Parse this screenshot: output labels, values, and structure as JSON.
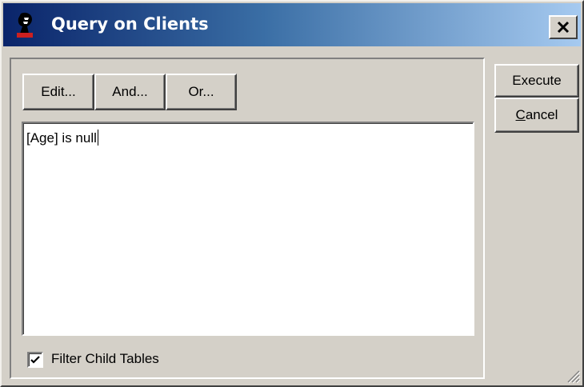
{
  "window": {
    "title": "Query on Clients",
    "close_label": "✕"
  },
  "toolbar": {
    "edit_label": "Edit...",
    "and_label": "And...",
    "or_label": "Or..."
  },
  "query": {
    "text": "[Age] is null"
  },
  "filter_child_tables": {
    "label": "Filter Child Tables",
    "checked": true
  },
  "actions": {
    "execute_label": "Execute",
    "cancel_label_first": "C",
    "cancel_label_rest": "ancel"
  },
  "colors": {
    "face": "#d4d0c8",
    "title_start": "#0a246a",
    "title_end": "#a6caf0"
  },
  "icons": [
    "app-icon",
    "close-icon",
    "checkmark-icon",
    "resize-grip-icon"
  ]
}
